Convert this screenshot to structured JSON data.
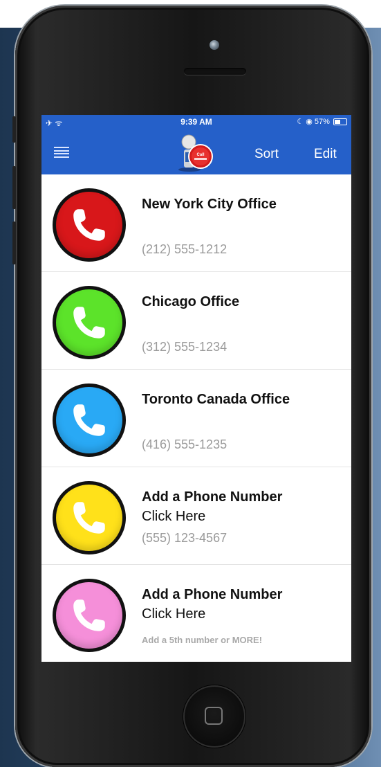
{
  "status_bar": {
    "left": "✈ ᯤ",
    "time": "9:39 AM",
    "right": "☾ ◉ 57%",
    "battery_level": 0.57
  },
  "nav": {
    "menu_icon": "hamburger-menu-icon",
    "logo_text": "Call",
    "sort_label": "Sort",
    "edit_label": "Edit",
    "bar_color": "#2560c9"
  },
  "contacts": [
    {
      "title": "New York City Office",
      "subtitle": "",
      "phone": "(212) 555-1212",
      "note": "",
      "color": "#d8171a",
      "icon": "phone-handset-icon"
    },
    {
      "title": "Chicago Office",
      "subtitle": "",
      "phone": "(312) 555-1234",
      "note": "",
      "color": "#5ce32a",
      "icon": "phone-handset-icon"
    },
    {
      "title": "Toronto Canada Office",
      "subtitle": "",
      "phone": "(416) 555-1235",
      "note": "",
      "color": "#29a9f5",
      "icon": "phone-handset-icon"
    },
    {
      "title": "Add a Phone Number",
      "subtitle": "Click Here",
      "phone": "(555) 123-4567",
      "note": "",
      "color": "#ffe11a",
      "icon": "phone-handset-icon"
    },
    {
      "title": "Add a Phone Number",
      "subtitle": "Click Here",
      "phone": "",
      "note": "Add a 5th number or MORE!",
      "color": "#f58fd9",
      "icon": "phone-handset-icon"
    }
  ]
}
